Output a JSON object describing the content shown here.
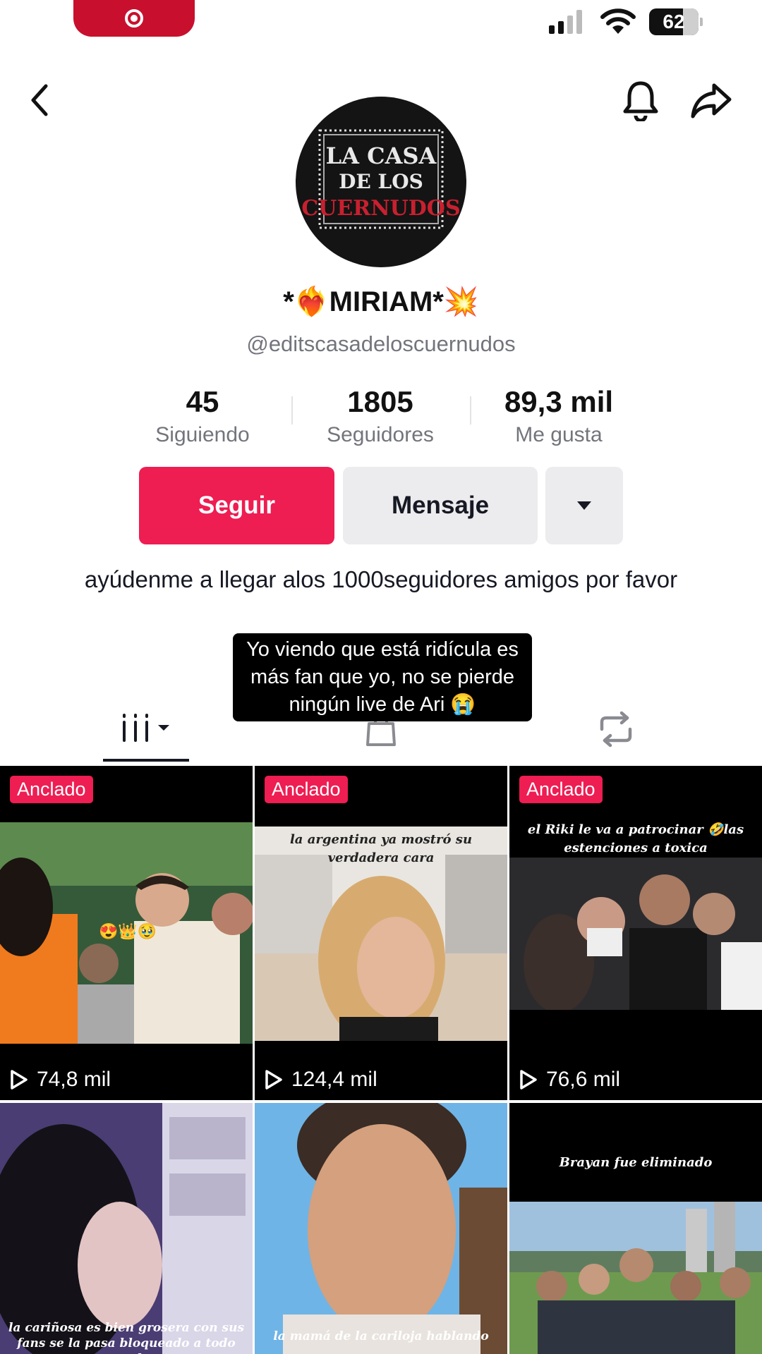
{
  "status_bar": {
    "battery": "62",
    "battery_level": 0.62
  },
  "profile": {
    "avatar_text": [
      "LA CASA",
      "DE LOS",
      "CUERNUDOS"
    ],
    "display_name": "*❤️‍🔥MIRIAM*💥",
    "handle": "@editscasadeloscuernudos",
    "stats": [
      {
        "value": "45",
        "label": "Siguiendo"
      },
      {
        "value": "1805",
        "label": "Seguidores"
      },
      {
        "value": "89,3 mil",
        "label": "Me gusta"
      }
    ],
    "follow_label": "Seguir",
    "message_label": "Mensaje",
    "bio": "ayúdenme a llegar alos 1000seguidores amigos por favor"
  },
  "overlay_caption": "Yo viendo que está ridícula es más fan que yo, no se pierde ningún live de Ari 😭",
  "videos": [
    {
      "pinned": "Anclado",
      "views": "74,8 mil",
      "text": "",
      "emoji": "😍👑🥹"
    },
    {
      "pinned": "Anclado",
      "views": "124,4 mil",
      "text": "la argentina ya mostró su verdadera cara"
    },
    {
      "pinned": "Anclado",
      "views": "76,6 mil",
      "text": "el Riki le va a patrocinar 🤣las estenciones a toxica"
    },
    {
      "pinned": "",
      "views": "",
      "text": "la cariñosa es bien grosera con sus fans se la pasa bloqueado a todo mundo"
    },
    {
      "pinned": "",
      "views": "",
      "text": "la mamá de la cariloja hablando"
    },
    {
      "pinned": "",
      "views": "",
      "text": "Brayan fue eliminado"
    }
  ],
  "colors": {
    "accent": "#ee1d52",
    "status_red": "#c8102e",
    "muted": "#73757c"
  }
}
